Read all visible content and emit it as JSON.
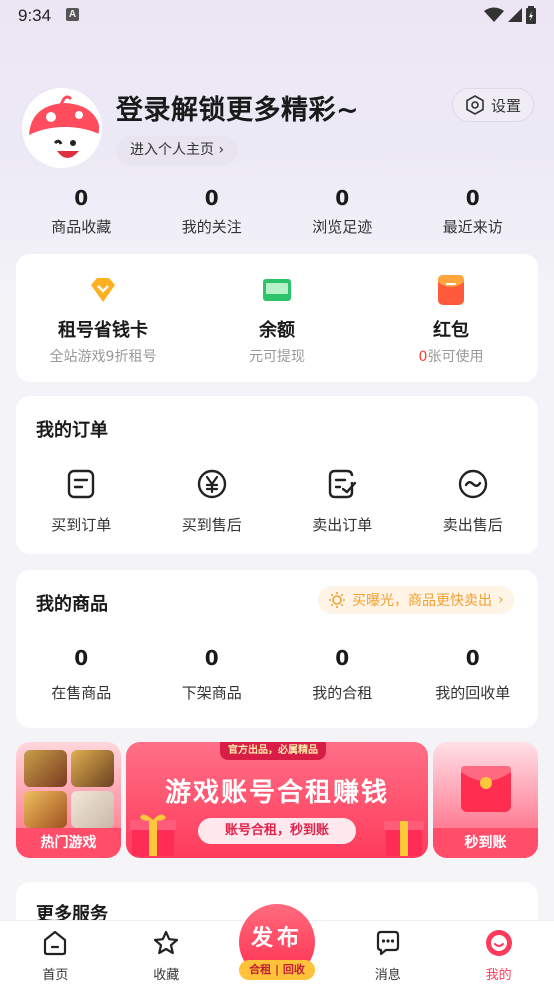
{
  "status": {
    "time": "9:34",
    "a_badge": "A"
  },
  "profile": {
    "title": "登录解锁更多精彩~",
    "home_link": "进入个人主页",
    "settings_label": "设置"
  },
  "stats": [
    {
      "value": "0",
      "label": "商品收藏"
    },
    {
      "value": "0",
      "label": "我的关注"
    },
    {
      "value": "0",
      "label": "浏览足迹"
    },
    {
      "value": "0",
      "label": "最近来访"
    }
  ],
  "wallet": [
    {
      "title": "租号省钱卡",
      "sub": "全站游戏9折租号"
    },
    {
      "title": "余额",
      "sub": "元可提现"
    },
    {
      "title": "红包",
      "sub_count": "0",
      "sub_text": "张可使用"
    }
  ],
  "orders": {
    "title": "我的订单",
    "items": [
      {
        "label": "买到订单",
        "icon": "doc-icon"
      },
      {
        "label": "买到售后",
        "icon": "yen-icon"
      },
      {
        "label": "卖出订单",
        "icon": "edit-doc-icon"
      },
      {
        "label": "卖出售后",
        "icon": "wave-icon"
      }
    ]
  },
  "goods": {
    "title": "我的商品",
    "promo": "买曝光，商品更快卖出",
    "items": [
      {
        "value": "0",
        "label": "在售商品"
      },
      {
        "value": "0",
        "label": "下架商品"
      },
      {
        "value": "0",
        "label": "我的合租"
      },
      {
        "value": "0",
        "label": "我的回收单"
      }
    ]
  },
  "banners": {
    "left_caption": "热门游戏",
    "mid_tag": "官方出品，必属精品",
    "mid_title": "游戏账号合租赚钱",
    "mid_sub": "账号合租，秒到账",
    "right_caption": "秒到账"
  },
  "more": {
    "title": "更多服务"
  },
  "tabbar": {
    "items": [
      {
        "label": "首页"
      },
      {
        "label": "收藏"
      },
      {
        "label": "消息"
      },
      {
        "label": "我的"
      }
    ],
    "publish_label": "发布",
    "publish_sub": "合租 | 回收"
  },
  "colors": {
    "accent": "#ff3b5c",
    "promo": "#f0a030"
  }
}
